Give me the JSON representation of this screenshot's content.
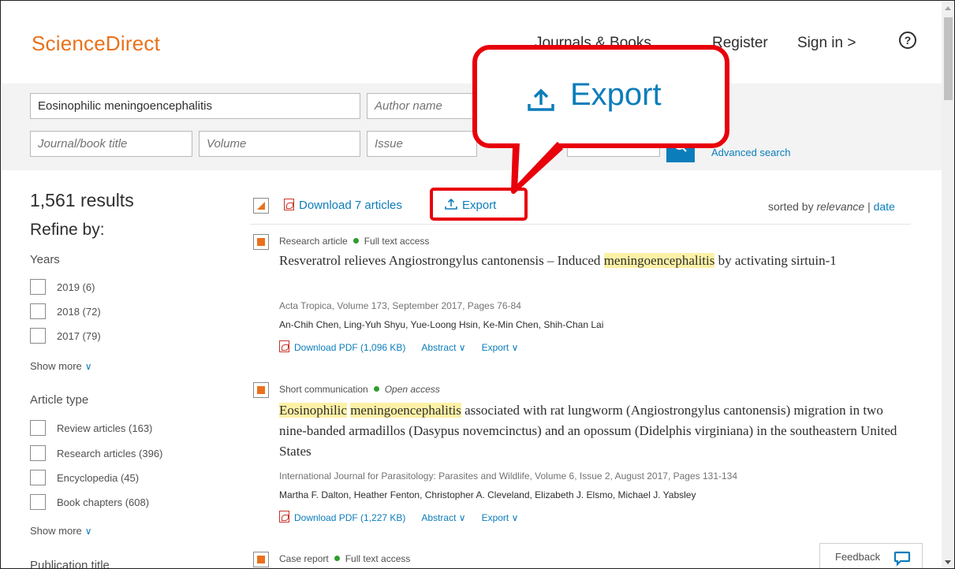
{
  "header": {
    "logo": "ScienceDirect",
    "nav": {
      "journals": "Journals & Books",
      "register": "Register",
      "signin": "Sign in >"
    },
    "help_icon": "?"
  },
  "search": {
    "keywords_value": "Eosinophilic meningoencephalitis",
    "author_placeholder": "Author name",
    "journal_placeholder": "Journal/book title",
    "volume_placeholder": "Volume",
    "issue_placeholder": "Issue",
    "advanced": "Advanced search"
  },
  "sidebar": {
    "results_count": "1,561 results",
    "refine": "Refine by:",
    "years_title": "Years",
    "years": [
      {
        "label": "2019 (6)"
      },
      {
        "label": "2018 (72)"
      },
      {
        "label": "2017 (79)"
      }
    ],
    "show_more": "Show more",
    "article_type_title": "Article type",
    "article_types": [
      {
        "label": "Review articles (163)"
      },
      {
        "label": "Research articles (396)"
      },
      {
        "label": "Encyclopedia (45)"
      },
      {
        "label": "Book chapters (608)"
      }
    ],
    "publication_title": "Publication title"
  },
  "toolbar": {
    "download": "Download 7 articles",
    "export": "Export",
    "sorted_by": "sorted by",
    "relevance": "relevance",
    "separator": "|",
    "date": "date"
  },
  "results": [
    {
      "type": "Research article",
      "access": "Full text access",
      "title_pre": "Resveratrol relieves Angiostrongylus cantonensis – Induced ",
      "title_hl": "meningoencephalitis",
      "title_post": " by activating sirtuin-1",
      "source": "Acta Tropica, Volume 173, September 2017, Pages 76-84",
      "authors": "An-Chih Chen, Ling-Yuh Shyu, Yue-Loong Hsin, Ke-Min Chen, Shih-Chan Lai",
      "pdf": "Download PDF (1,096 KB)",
      "abstract": "Abstract",
      "export": "Export"
    },
    {
      "type": "Short communication",
      "access": "Open access",
      "title_hl1": "Eosinophilic",
      "title_hl2": "meningoencephalitis",
      "title_post": " associated with rat lungworm (Angiostrongylus cantonensis) migration in two nine-banded armadillos (Dasypus novemcinctus) and an opossum (Didelphis virginiana) in the southeastern United States",
      "source": "International Journal for Parasitology: Parasites and Wildlife, Volume 6, Issue 2, August 2017, Pages 131-134",
      "authors": "Martha F. Dalton, Heather Fenton, Christopher A. Cleveland, Elizabeth J. Elsmo, Michael J. Yabsley",
      "pdf": "Download PDF (1,227 KB)",
      "abstract": "Abstract",
      "export": "Export"
    },
    {
      "type": "Case report",
      "access": "Full text access"
    }
  ],
  "feedback": "Feedback",
  "callout": {
    "label": "Export"
  },
  "colors": {
    "brand": "#e9711c",
    "link": "#0c7dbb",
    "callout": "#e8000b",
    "highlight": "#fdf1a6",
    "access_dot": "#2e9e2e"
  },
  "icons": {
    "chevron": "chevron-down-icon",
    "pdf": "pdf-icon",
    "export": "export-icon",
    "search": "search-icon",
    "feedback": "speech-bubble-icon"
  }
}
